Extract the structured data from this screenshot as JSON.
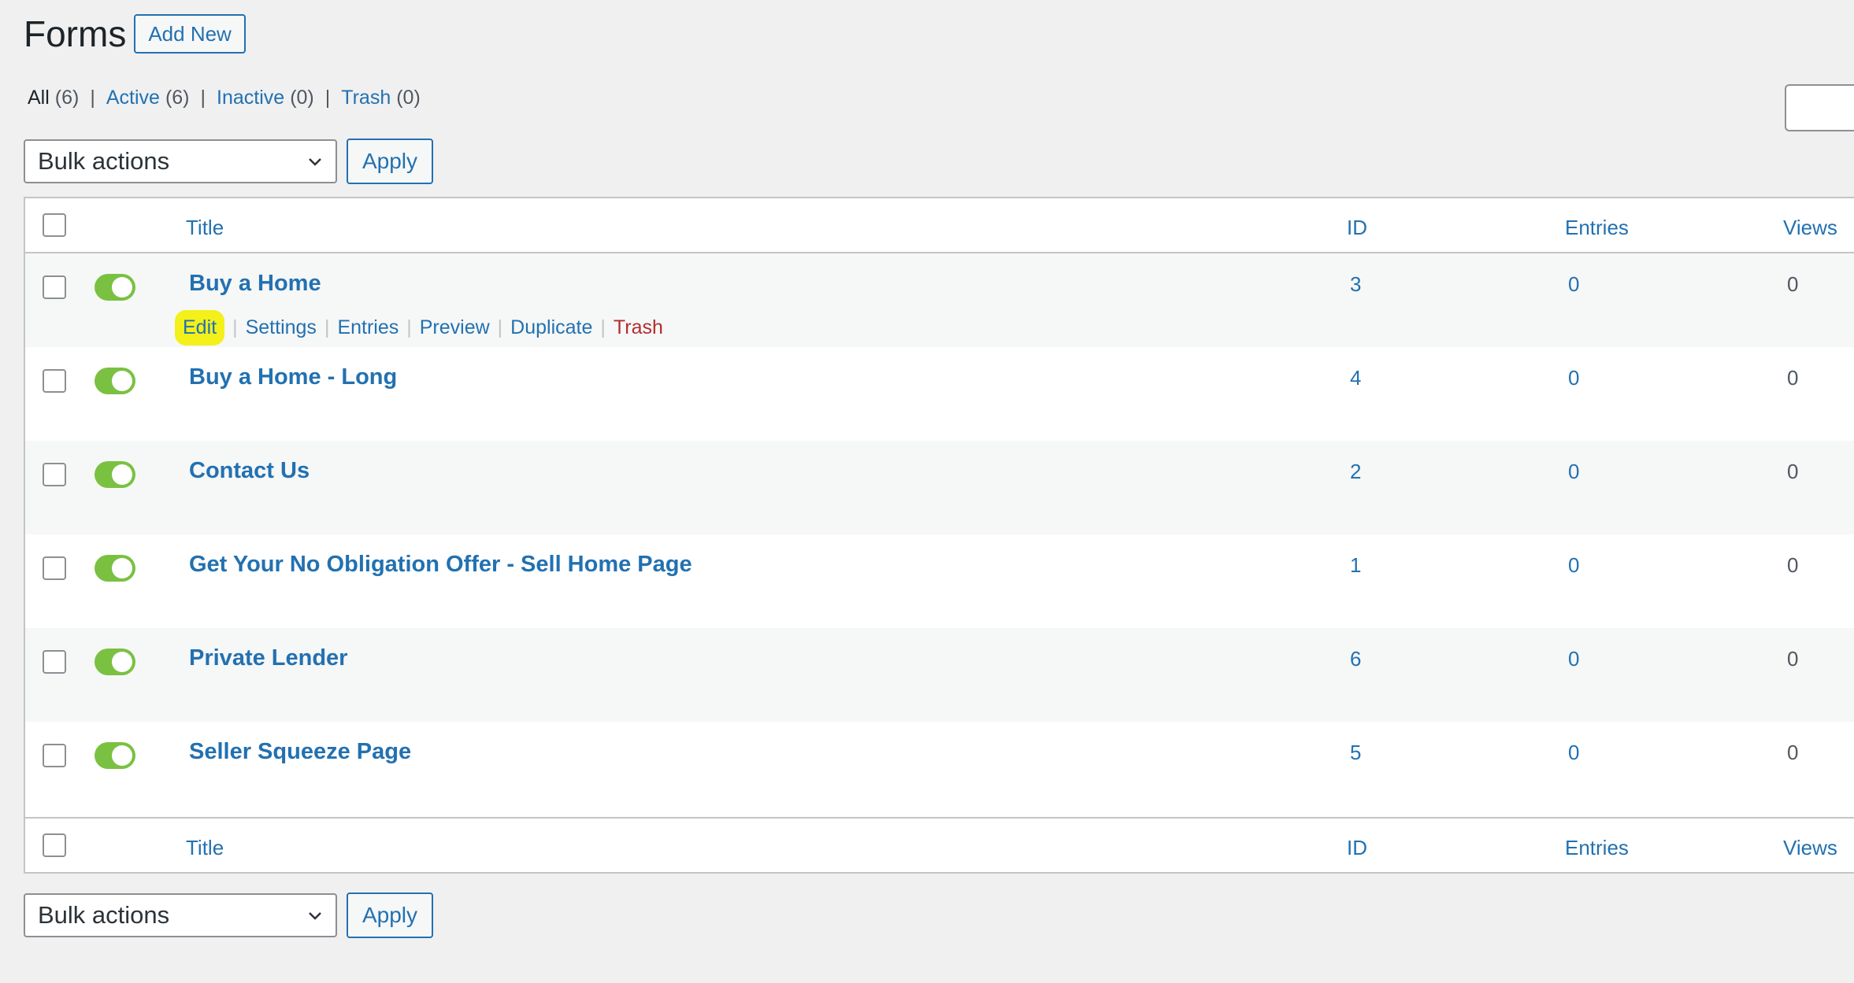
{
  "header": {
    "title": "Forms",
    "add_new": "Add New"
  },
  "filters": [
    {
      "label": "All",
      "count": "(6)",
      "current": true
    },
    {
      "label": "Active",
      "count": "(6)",
      "current": false
    },
    {
      "label": "Inactive",
      "count": "(0)",
      "current": false
    },
    {
      "label": "Trash",
      "count": "(0)",
      "current": false
    }
  ],
  "bulk": {
    "select_label": "Bulk actions",
    "apply_label": "Apply"
  },
  "columns": {
    "title": "Title",
    "id": "ID",
    "entries": "Entries",
    "views": "Views"
  },
  "row_actions": {
    "edit": "Edit",
    "settings": "Settings",
    "entries": "Entries",
    "preview": "Preview",
    "duplicate": "Duplicate",
    "trash": "Trash"
  },
  "rows": [
    {
      "title": "Buy a Home",
      "id": "3",
      "entries": "0",
      "views": "0",
      "active": true
    },
    {
      "title": "Buy a Home - Long",
      "id": "4",
      "entries": "0",
      "views": "0",
      "active": true
    },
    {
      "title": "Contact Us",
      "id": "2",
      "entries": "0",
      "views": "0",
      "active": true
    },
    {
      "title": "Get Your No Obligation Offer - Sell Home Page",
      "id": "1",
      "entries": "0",
      "views": "0",
      "active": true
    },
    {
      "title": "Private Lender",
      "id": "6",
      "entries": "0",
      "views": "0",
      "active": true
    },
    {
      "title": "Seller Squeeze Page",
      "id": "5",
      "entries": "0",
      "views": "0",
      "active": true
    }
  ],
  "colors": {
    "link": "#2271b1",
    "toggle_on": "#7ac142",
    "trash": "#b32d2e",
    "highlight": "#f3f01a"
  }
}
